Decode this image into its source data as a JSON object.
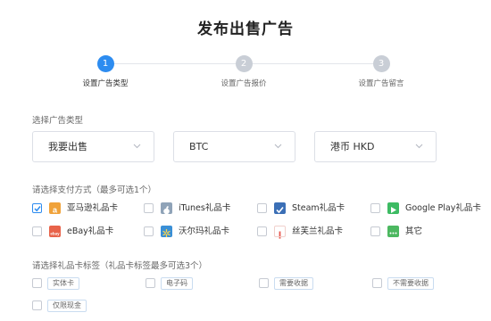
{
  "page": {
    "title": "发布出售广告"
  },
  "steps": [
    {
      "number": "1",
      "label": "设置广告类型",
      "active": true
    },
    {
      "number": "2",
      "label": "设置广告报价",
      "active": false
    },
    {
      "number": "3",
      "label": "设置广告留言",
      "active": false
    }
  ],
  "ad_type": {
    "label": "选择广告类型",
    "selects": [
      {
        "value": "我要出售"
      },
      {
        "value": "BTC"
      },
      {
        "value": "港币 HKD"
      }
    ]
  },
  "payment": {
    "label": "请选择支付方式（最多可选1个）",
    "options": [
      {
        "label": "亚马逊礼品卡",
        "checked": true,
        "icon": "amazon-icon",
        "color": "#f0a23a",
        "glyph": "a"
      },
      {
        "label": "iTunes礼品卡",
        "checked": false,
        "icon": "apple-icon",
        "color": "#8fa3b8",
        "glyph": ""
      },
      {
        "label": "Steam礼品卡",
        "checked": false,
        "icon": "steam-icon",
        "color": "#3b6fb6",
        "glyph": "✔"
      },
      {
        "label": "Google Play礼品卡",
        "checked": false,
        "icon": "google-play-icon",
        "color": "#3dbb63",
        "glyph": "▶"
      },
      {
        "label": "eBay礼品卡",
        "checked": false,
        "icon": "ebay-icon",
        "color": "#e8634a",
        "glyph": "ebay"
      },
      {
        "label": "沃尔玛礼品卡",
        "checked": false,
        "icon": "walmart-icon",
        "color": "#3a8fd6",
        "glyph": "✳"
      },
      {
        "label": "丝芙兰礼品卡",
        "checked": false,
        "icon": "sephora-icon",
        "color": "#e8584f",
        "glyph": "!"
      },
      {
        "label": "其它",
        "checked": false,
        "icon": "more-icon",
        "color": "#4cb860",
        "glyph": "•••"
      }
    ]
  },
  "tags": {
    "label": "请选择礼品卡标签（礼品卡标签最多可选3个）",
    "options": [
      {
        "label": "实体卡",
        "checked": false
      },
      {
        "label": "电子码",
        "checked": false
      },
      {
        "label": "需要收据",
        "checked": false
      },
      {
        "label": "不需要收据",
        "checked": false
      },
      {
        "label": "仅限现金",
        "checked": false
      }
    ]
  },
  "colors": {
    "accent": "#2d8cf0",
    "inactive_step": "#c9ced6",
    "border": "#dcdfe6"
  }
}
